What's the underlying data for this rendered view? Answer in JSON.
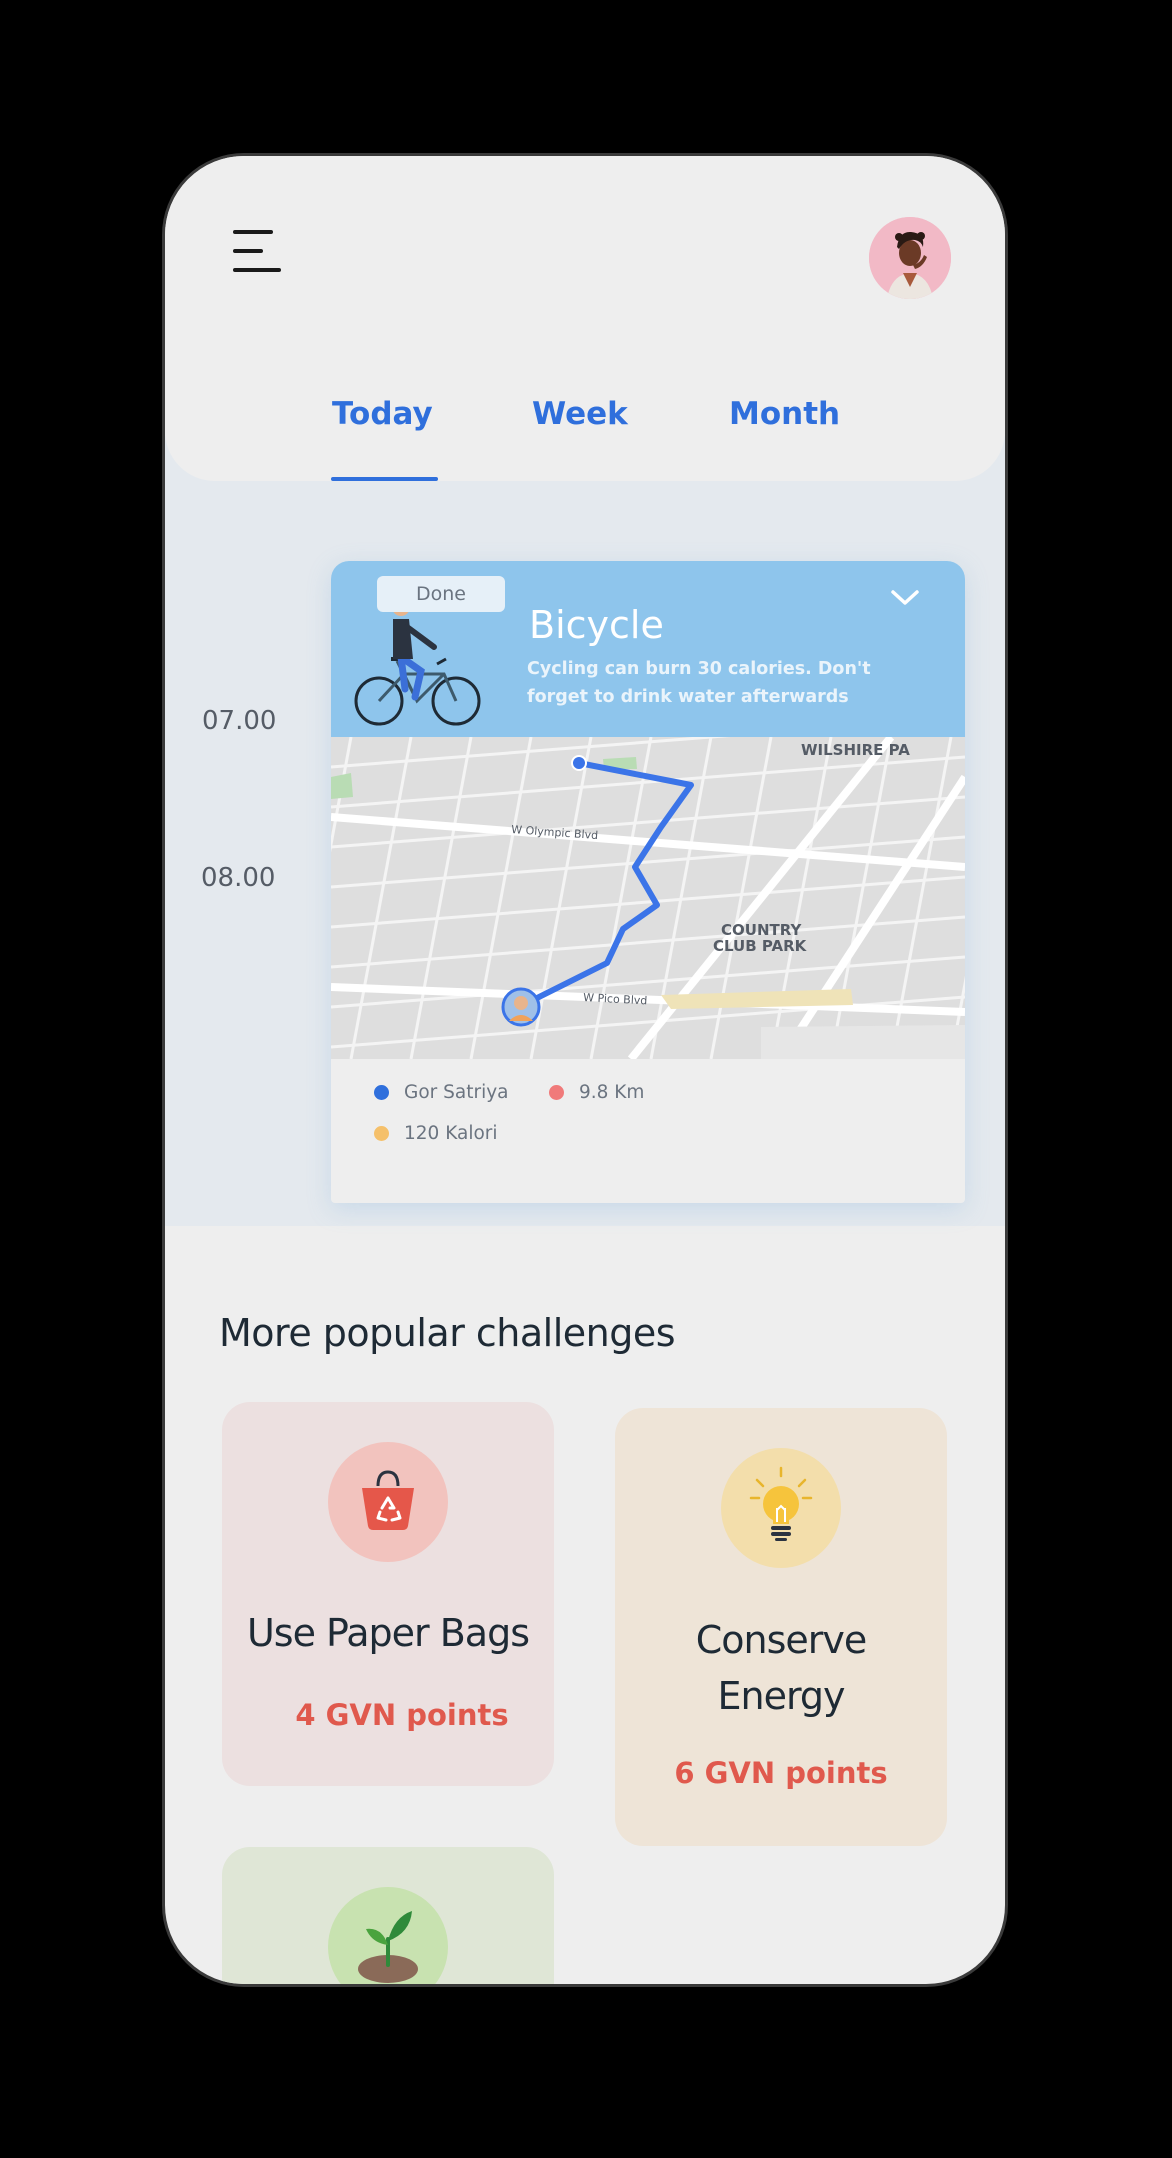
{
  "tabs": [
    {
      "label": "Today",
      "active": true
    },
    {
      "label": "Week",
      "active": false
    },
    {
      "label": "Month",
      "active": false
    }
  ],
  "timeline": {
    "times": [
      "07.00",
      "08.00"
    ]
  },
  "activity": {
    "badge": "Done",
    "title": "Bicycle",
    "description": "Cycling can burn 30 calories. Don't forget to drink water afterwards",
    "map_labels": {
      "area_1": "WILSHIRE PA",
      "street_1": "W Olympic Blvd",
      "park_line_1": "COUNTRY",
      "park_line_2": "CLUB PARK",
      "street_2": "W Pico Blvd"
    },
    "legend": [
      {
        "label": "Gor Satriya",
        "color": "#2f6fdc"
      },
      {
        "label": "9.8 Km",
        "color": "#f07a7a"
      },
      {
        "label": "120 Kalori",
        "color": "#f5c06a"
      }
    ]
  },
  "challenges": {
    "title": "More popular challenges",
    "items": [
      {
        "name": "Use Paper Bags",
        "points": "4 GVN points",
        "icon": "recycle-bag-icon"
      },
      {
        "name": "Conserve Energy",
        "points": "6 GVN points",
        "icon": "lightbulb-icon"
      },
      {
        "name": "",
        "points": "",
        "icon": "plant-sprout-icon"
      }
    ]
  },
  "colors": {
    "accent": "#2f6fdc",
    "card_header": "#8ec5ec",
    "points": "#e0594d"
  }
}
